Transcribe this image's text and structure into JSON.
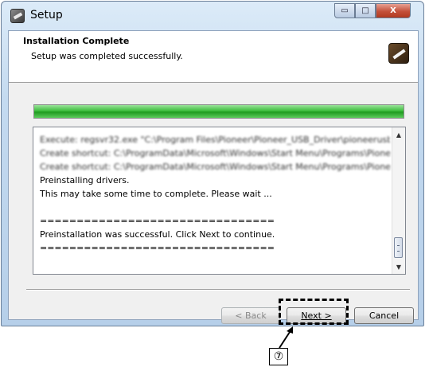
{
  "window": {
    "title": "Setup",
    "minimize_glyph": "▭",
    "maximize_glyph": "□",
    "close_glyph": "X"
  },
  "header": {
    "title": "Installation Complete",
    "subtitle": "Setup was completed successfully."
  },
  "progress": {
    "value_percent": 100,
    "color": "#2fae2f"
  },
  "log": {
    "lines": [
      {
        "text": "Execute: regsvr32.exe \"C:\\Program Files\\Pioneer\\Pioneer_USB_Driver\\pioneerusb_usb...",
        "obscured": true
      },
      {
        "text": "Create shortcut: C:\\ProgramData\\Microsoft\\Windows\\Start Menu\\Programs\\Pioneer...",
        "obscured": true
      },
      {
        "text": "Create shortcut: C:\\ProgramData\\Microsoft\\Windows\\Start Menu\\Programs\\Pioneer...",
        "obscured": true
      },
      {
        "text": "Preinstalling drivers.",
        "obscured": false
      },
      {
        "text": "This may take some time to complete. Please wait ...",
        "obscured": false
      },
      {
        "text": "",
        "obscured": false
      },
      {
        "text": "================================",
        "obscured": false
      },
      {
        "text": "Preinstallation was successful. Click Next to continue.",
        "obscured": false
      },
      {
        "text": "================================",
        "obscured": false
      }
    ]
  },
  "buttons": {
    "back": "< Back",
    "next": "Next >",
    "cancel": "Cancel"
  },
  "annotation": {
    "callout_label": "⑦"
  },
  "colors": {
    "accent_progress": "#2fae2f",
    "close_button": "#c4503a"
  }
}
